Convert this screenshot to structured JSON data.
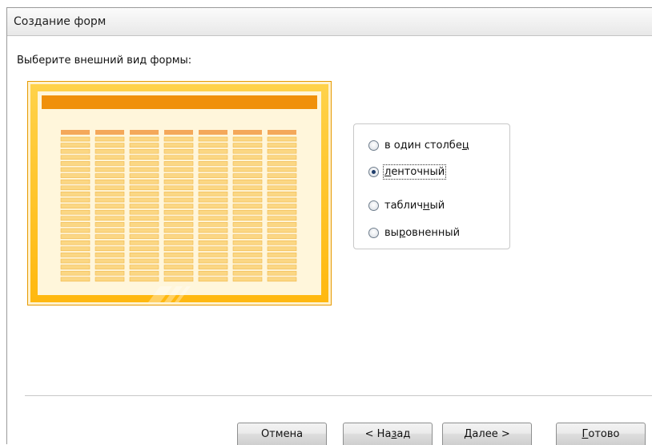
{
  "window": {
    "title": "Создание форм"
  },
  "prompt": "Выберите внешний вид формы:",
  "layout_options": {
    "selected_index": 1,
    "items": [
      {
        "before": "в один столбе",
        "mnemonic": "ц",
        "after": ""
      },
      {
        "before": "",
        "mnemonic": "л",
        "after": "енточный"
      },
      {
        "before": "таблич",
        "mnemonic": "н",
        "after": "ый"
      },
      {
        "before": "вы",
        "mnemonic": "р",
        "after": "овненный"
      }
    ]
  },
  "buttons": [
    {
      "before": "Отмена",
      "mnemonic": "",
      "after": ""
    },
    {
      "before": "< На",
      "mnemonic": "з",
      "after": "ад"
    },
    {
      "before": "",
      "mnemonic": "Д",
      "after": "алее >"
    },
    {
      "before": "",
      "mnemonic": "Г",
      "after": "отово"
    }
  ],
  "colors": {
    "preview_border": "#e69a00",
    "preview_header": "#f0900a",
    "preview_frame": "#ffbe1e",
    "field_header": "#f4a85a",
    "field_cell": "#fbd784"
  }
}
